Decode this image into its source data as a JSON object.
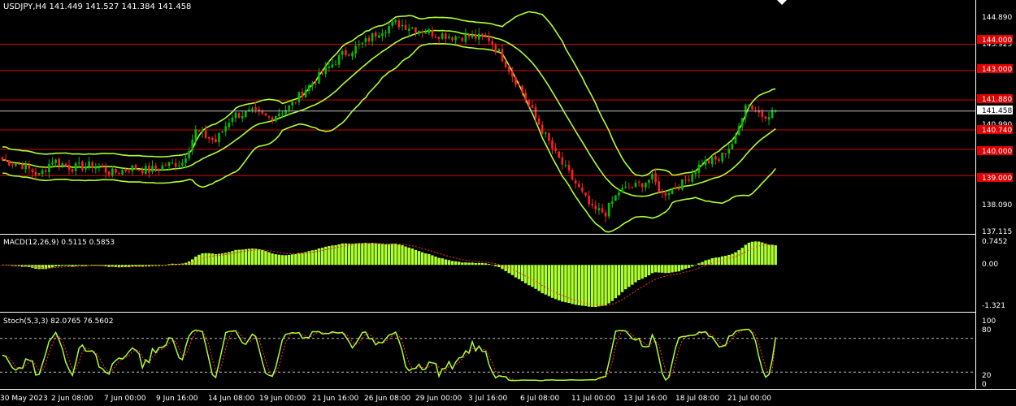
{
  "colors": {
    "background": "#000000",
    "grid_text": "#ffffff",
    "bull": "#00c000",
    "bear": "#ff2020",
    "bands": "#adff2f",
    "level": "#d40000",
    "level_label_bg": "#e00000",
    "macd_hist": "#adff2f",
    "signal": "#ff3030",
    "stoch_main": "#adff2f",
    "stoch_signal": "#ff3030"
  },
  "header": {
    "title": "USDJPY,H4  141.449 141.527 141.384 141.458",
    "dropdown_icon": "triangle-down-icon"
  },
  "price_axis": {
    "ticks": [
      "144.890",
      "143.925",
      "140.990",
      "138.090",
      "137.115"
    ],
    "current_price": "141.458"
  },
  "levels": [
    "144.000",
    "143.000",
    "141.880",
    "140.740",
    "140.000",
    "139.000"
  ],
  "macd": {
    "label": "MACD(12,26,9) 0.5115 0.5853",
    "ticks": [
      "0.7452",
      "0.00",
      "-1.321"
    ]
  },
  "stoch": {
    "label": "Stoch(5,3,3) 82.0765 76.5602",
    "ticks": [
      "100",
      "80",
      "20",
      "0"
    ]
  },
  "time_axis": [
    "30 May 2023",
    "2 Jun 08:00",
    "7 Jun 00:00",
    "9 Jun 16:00",
    "14 Jun 08:00",
    "19 Jun 00:00",
    "21 Jun 16:00",
    "26 Jun 08:00",
    "29 Jun 00:00",
    "3 Jul 16:00",
    "6 Jul 08:00",
    "11 Jul 00:00",
    "13 Jul 16:00",
    "18 Jul 08:00",
    "21 Jul 00:00"
  ],
  "chart_data": {
    "type": "candlestick",
    "symbol": "USDJPY",
    "timeframe": "H4",
    "last_bar": {
      "open": 141.449,
      "high": 141.527,
      "low": 141.384,
      "close": 141.458
    },
    "close_anchors": [
      [
        0,
        139.6
      ],
      [
        6,
        139.4
      ],
      [
        11,
        139.0
      ],
      [
        15,
        139.6
      ],
      [
        21,
        139.3
      ],
      [
        27,
        139.4
      ],
      [
        33,
        139.1
      ],
      [
        39,
        139.3
      ],
      [
        44,
        139.2
      ],
      [
        49,
        139.4
      ],
      [
        54,
        139.5
      ],
      [
        58,
        140.7
      ],
      [
        64,
        140.3
      ],
      [
        69,
        141.3
      ],
      [
        75,
        141.4
      ],
      [
        80,
        141.2
      ],
      [
        86,
        141.6
      ],
      [
        91,
        142.3
      ],
      [
        97,
        143.0
      ],
      [
        102,
        143.6
      ],
      [
        108,
        144.0
      ],
      [
        113,
        144.5
      ],
      [
        118,
        144.8
      ],
      [
        124,
        144.6
      ],
      [
        130,
        144.4
      ],
      [
        135,
        144.3
      ],
      [
        140,
        144.3
      ],
      [
        146,
        144.2
      ],
      [
        150,
        143.5
      ],
      [
        155,
        142.4
      ],
      [
        160,
        141.2
      ],
      [
        166,
        139.8
      ],
      [
        172,
        138.7
      ],
      [
        177,
        137.7
      ],
      [
        181,
        137.6
      ],
      [
        185,
        138.4
      ],
      [
        190,
        138.6
      ],
      [
        195,
        138.9
      ],
      [
        198,
        138.3
      ],
      [
        204,
        138.7
      ],
      [
        210,
        139.5
      ],
      [
        215,
        139.6
      ],
      [
        220,
        140.4
      ],
      [
        223,
        141.8
      ],
      [
        228,
        141.3
      ],
      [
        232,
        141.46
      ]
    ],
    "levels": [
      144.0,
      143.0,
      141.88,
      140.74,
      140.0,
      139.0
    ],
    "price_range": [
      136.85,
      145.25
    ],
    "macd": {
      "fast": 12,
      "slow": 26,
      "signal": 9,
      "value": 0.5115,
      "signal_value": 0.5853,
      "range": [
        -1.321,
        0.7452
      ]
    },
    "stochastic": {
      "k": 5,
      "d": 3,
      "slowing": 3,
      "main": 82.0765,
      "signal": 76.5602,
      "range": [
        0,
        100
      ],
      "levels": [
        20,
        80
      ]
    }
  }
}
